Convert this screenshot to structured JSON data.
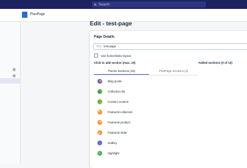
{
  "topbar": {
    "search_placeholder": "Search",
    "app_name": "PlusPage"
  },
  "page": {
    "title": "Edit - test-page"
  },
  "card": {
    "heading": "Page Details",
    "title_field": {
      "label": "Title",
      "value": "test-page"
    },
    "checkbox_label": "Use home/index layout",
    "click_to_add": "Click to add section (max. 10)",
    "added_sections": "Added sections (0 of 10)",
    "tabs": [
      {
        "label": "Theme Sections (15)"
      },
      {
        "label": "PlusPage Sections (4)"
      }
    ],
    "sections": [
      {
        "label": "Blog posts"
      },
      {
        "label": "Collection list"
      },
      {
        "label": "Custom content"
      },
      {
        "label": "Featured collection"
      },
      {
        "label": "Featured product"
      },
      {
        "label": "Featured slider"
      },
      {
        "label": "Gallery"
      },
      {
        "label": "Highlight"
      }
    ]
  },
  "colors": {
    "topbar": "#1c2260",
    "tab_active": "#5c6ac4",
    "icon_blue": "#5c6ac4",
    "icon_green": "#50b83c",
    "icon_orange": "#f49342"
  }
}
